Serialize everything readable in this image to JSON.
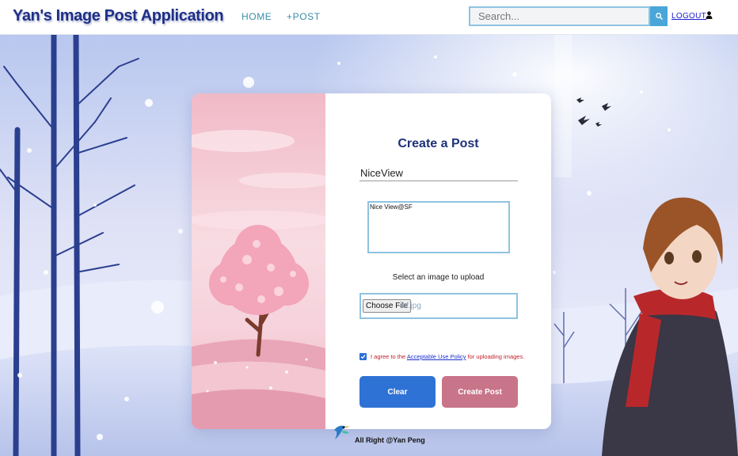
{
  "header": {
    "brand": "Yan's Image Post Application",
    "nav": {
      "home": "HOME",
      "post": "+POST"
    },
    "search": {
      "placeholder": "Search...",
      "icon": "search-icon"
    },
    "logout": "LOGOUT",
    "user_icon": "user-icon"
  },
  "form": {
    "title": "Create a Post",
    "post_title_value": "NiceView",
    "description_value": "Nice View@SF",
    "upload_label": "Select an image to upload",
    "choose_file_label": "Choose File",
    "file_name": "sf.jpg",
    "agree": {
      "checked": true,
      "prefix": "I agree to the ",
      "link_text": "Acceptable Use Policy",
      "suffix": " for uploading images."
    },
    "clear_label": "Clear",
    "create_label": "Create Post"
  },
  "footer": {
    "text": "All Right @Yan Peng"
  },
  "colors": {
    "brand": "#1d2f87",
    "nav": "#3b8ea8",
    "clear_button": "#2f72d6",
    "create_button": "#c87489",
    "policy_text": "#c2222b"
  }
}
